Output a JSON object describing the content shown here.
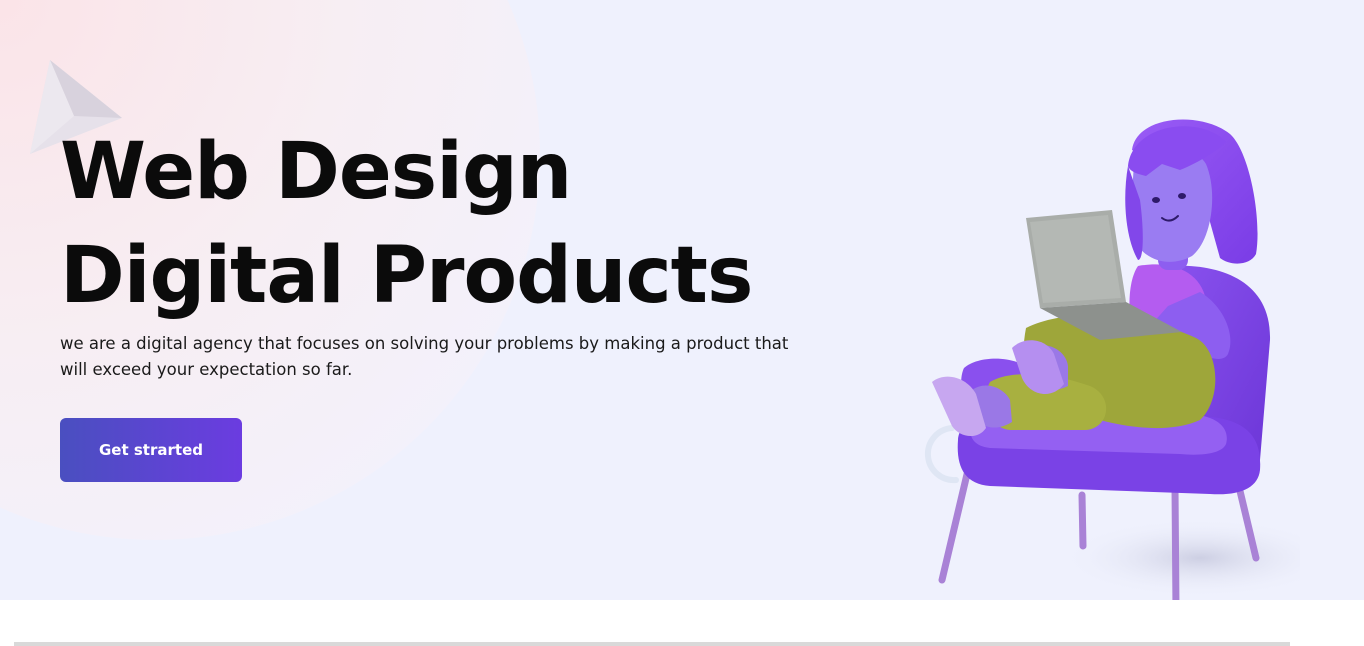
{
  "hero": {
    "title_line1": "Web Design",
    "title_line2": "Digital Products",
    "subtitle": "we are a digital agency that focuses on solving your problems by making a product that will exceed your expectation so far.",
    "cta_label": "Get strarted"
  },
  "colors": {
    "hero_background": "#eff1fd",
    "button_gradient_start": "#4a4fc0",
    "button_gradient_end": "#6b3ce0",
    "title_text": "#0b0b0b",
    "character_hair": "#8a4cf0",
    "chair": "#7b44e8",
    "pants": "#9ea63a",
    "shirt": "#b45cf0",
    "laptop": "#a9ada9"
  },
  "icons": {
    "decoration": "pyramid-icon",
    "illustration": "person-with-laptop-in-chair"
  }
}
